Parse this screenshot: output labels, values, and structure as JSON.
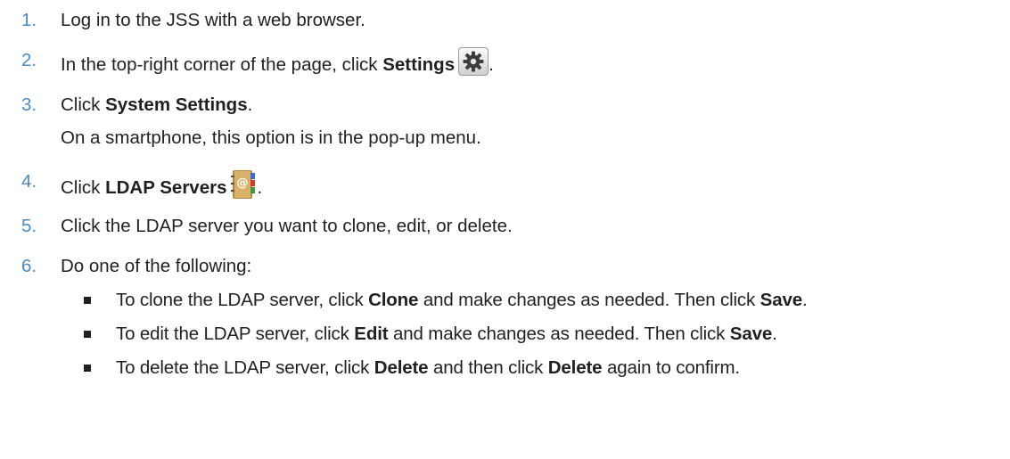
{
  "steps": [
    {
      "num": "1.",
      "text": "Log in to the JSS with a web browser."
    },
    {
      "num": "2.",
      "pre": "In the top-right corner of the page, click ",
      "bold": "Settings",
      "post": ".",
      "icon": "gear-icon"
    },
    {
      "num": "3.",
      "pre": "Click ",
      "bold": "System Settings",
      "post": ".",
      "subtext": "On a smartphone, this option is in the pop-up menu."
    },
    {
      "num": "4.",
      "pre": "Click ",
      "bold": "LDAP Servers",
      "post": ".",
      "icon": "address-book-icon"
    },
    {
      "num": "5.",
      "text": "Click the LDAP server you want to clone, edit, or delete."
    },
    {
      "num": "6.",
      "text": "Do one of the following:"
    }
  ],
  "bullets": [
    {
      "a": "To clone the LDAP server, click ",
      "b": "Clone",
      "c": " and make changes as needed. Then click ",
      "d": "Save",
      "e": "."
    },
    {
      "a": "To edit the LDAP server, click ",
      "b": "Edit",
      "c": " and make changes as needed. Then click ",
      "d": "Save",
      "e": "."
    },
    {
      "a": "To delete the LDAP server, click ",
      "b": "Delete",
      "c": " and then click ",
      "d": "Delete",
      "e": " again to confirm."
    }
  ],
  "colors": {
    "step_number": "#4a8cc4",
    "text": "#231f20"
  }
}
